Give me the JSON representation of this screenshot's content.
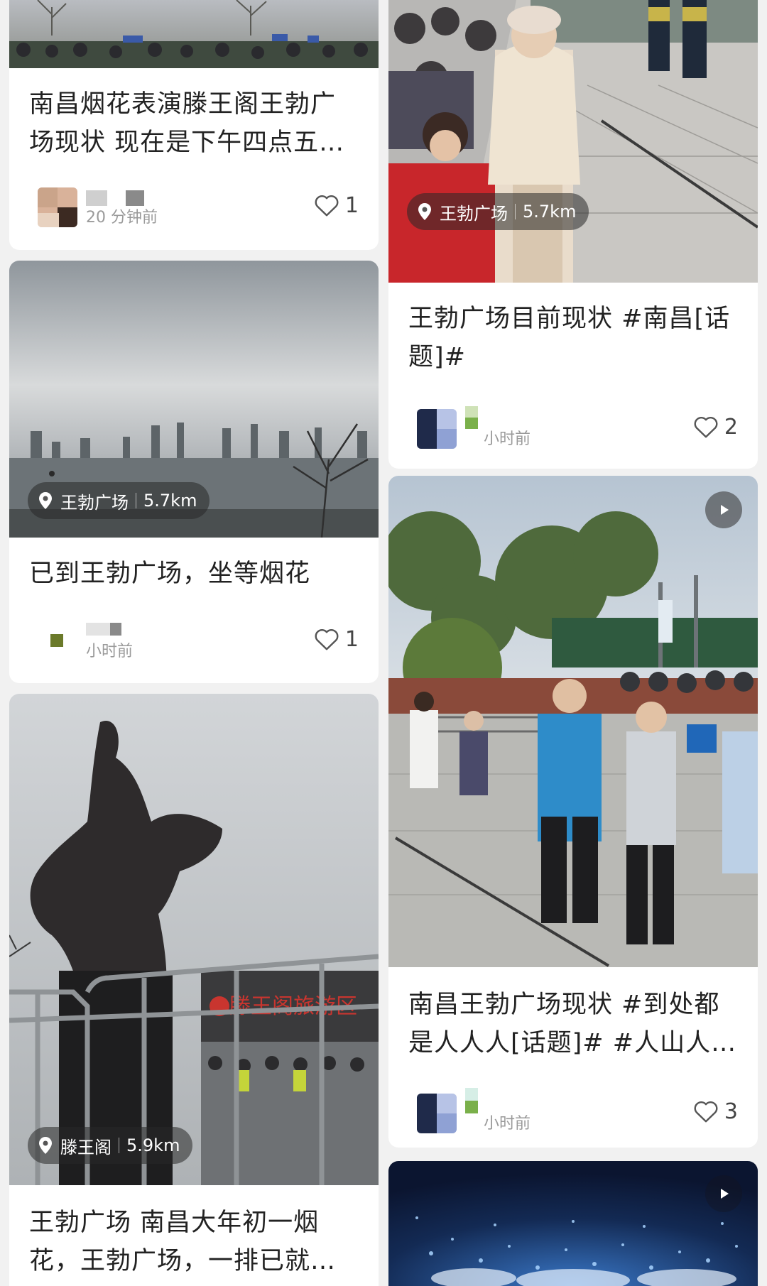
{
  "feed": {
    "cards": [
      {
        "title": "南昌烟花表演滕王阁王勃广场现状 现在是下午四点五…",
        "time": "20 分钟前",
        "likes": "1"
      },
      {
        "title": "王勃广场目前现状 #南昌[话题]#",
        "location": {
          "name": "王勃广场",
          "distance": "5.7km"
        },
        "time": "小时前",
        "likes": "2"
      },
      {
        "title": "已到王勃广场，坐等烟花",
        "location": {
          "name": "王勃广场",
          "distance": "5.7km"
        },
        "time": "小时前",
        "likes": "1"
      },
      {
        "title": "南昌王勃广场现状 #到处都是人人人[话题]# #人山人…",
        "time": "小时前",
        "likes": "3",
        "video": true
      },
      {
        "title": "王勃广场 南昌大年初一烟花，王勃广场，一排已就…",
        "location": {
          "name": "滕王阁",
          "distance": "5.9km"
        }
      },
      {
        "video": true
      }
    ]
  },
  "photo_signage": {
    "board_text": "滕王阁旅游区"
  },
  "icons": {
    "like": "heart-outline-icon",
    "location": "location-pin-icon",
    "video": "play-icon"
  },
  "colors": {
    "background": "#f1f1f1",
    "card": "#ffffff",
    "text": "#222222",
    "muted": "#9a9a9a"
  }
}
